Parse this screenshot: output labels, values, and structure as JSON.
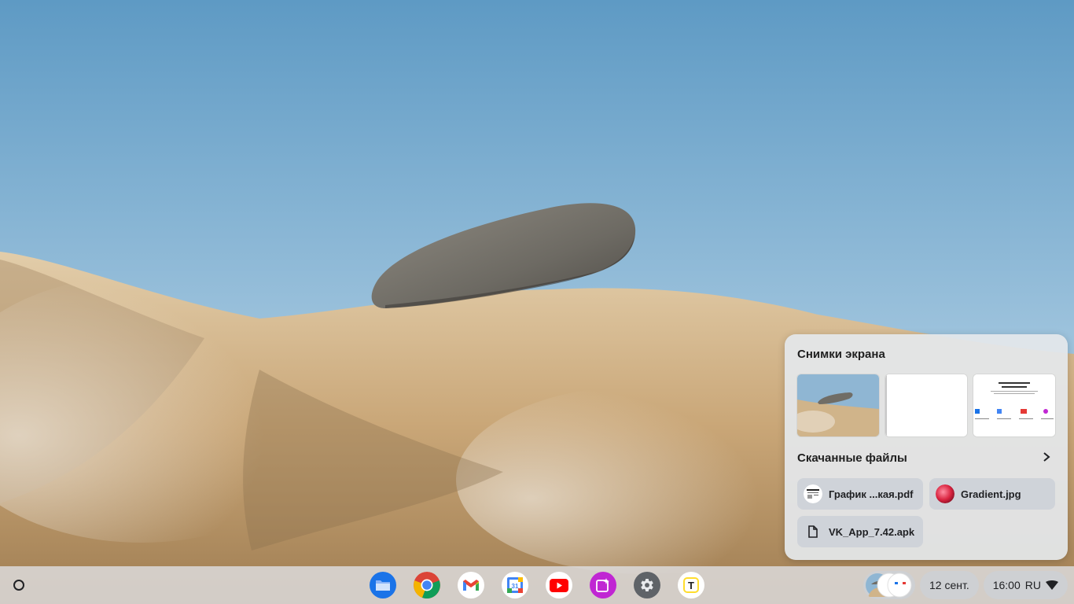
{
  "holding_space": {
    "screenshots_title": "Снимки экрана",
    "downloads_title": "Скачанные файлы",
    "screenshots": [
      {
        "kind": "wallpaper"
      },
      {
        "kind": "blank"
      },
      {
        "kind": "webpage"
      }
    ],
    "files": [
      {
        "name": "График ...кая.pdf",
        "icon": "pdf-thumbnail-icon"
      },
      {
        "name": "Gradient.jpg",
        "icon": "gradient-thumbnail-icon"
      },
      {
        "name": "VK_App_7.42.apk",
        "icon": "file-icon"
      }
    ]
  },
  "shelf": {
    "apps": [
      {
        "name": "Files",
        "icon": "folder-icon",
        "color": "#1a73e8"
      },
      {
        "name": "Chrome",
        "icon": "chrome-icon",
        "color": "#ea4335"
      },
      {
        "name": "Gmail",
        "icon": "gmail-icon",
        "color": "#ffffff"
      },
      {
        "name": "Calendar",
        "icon": "calendar-icon",
        "color": "#ffffff",
        "label": "31"
      },
      {
        "name": "YouTube",
        "icon": "youtube-icon",
        "color": "#ffffff"
      },
      {
        "name": "Gallery",
        "icon": "gallery-icon",
        "color": "#c026d3"
      },
      {
        "name": "Settings",
        "icon": "gear-icon",
        "color": "#5f6368"
      },
      {
        "name": "Tinkoff",
        "icon": "t-app-icon",
        "color": "#ffffff",
        "label": "T"
      }
    ],
    "date": "12 сент.",
    "time": "16:00",
    "input_language": "RU"
  }
}
